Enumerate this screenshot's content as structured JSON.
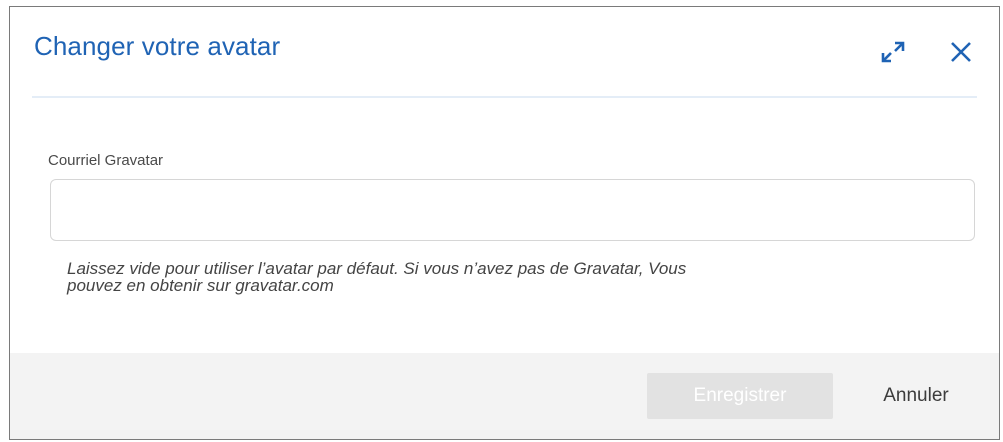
{
  "dialog": {
    "title": "Changer votre avatar",
    "icons": {
      "expand": "expand-arrows-icon",
      "close": "close-icon"
    },
    "accent_color": "#1f63b4"
  },
  "form": {
    "email_label": "Courriel Gravatar",
    "email_value": "",
    "email_placeholder": "",
    "help_line1": "Laissez vide pour utiliser l’avatar par défaut. Si vous n’avez pas de Gravatar, Vous",
    "help_line2": "pouvez en obtenir sur gravatar.com"
  },
  "footer": {
    "save_label": "Enregistrer",
    "cancel_label": "Annuler"
  }
}
